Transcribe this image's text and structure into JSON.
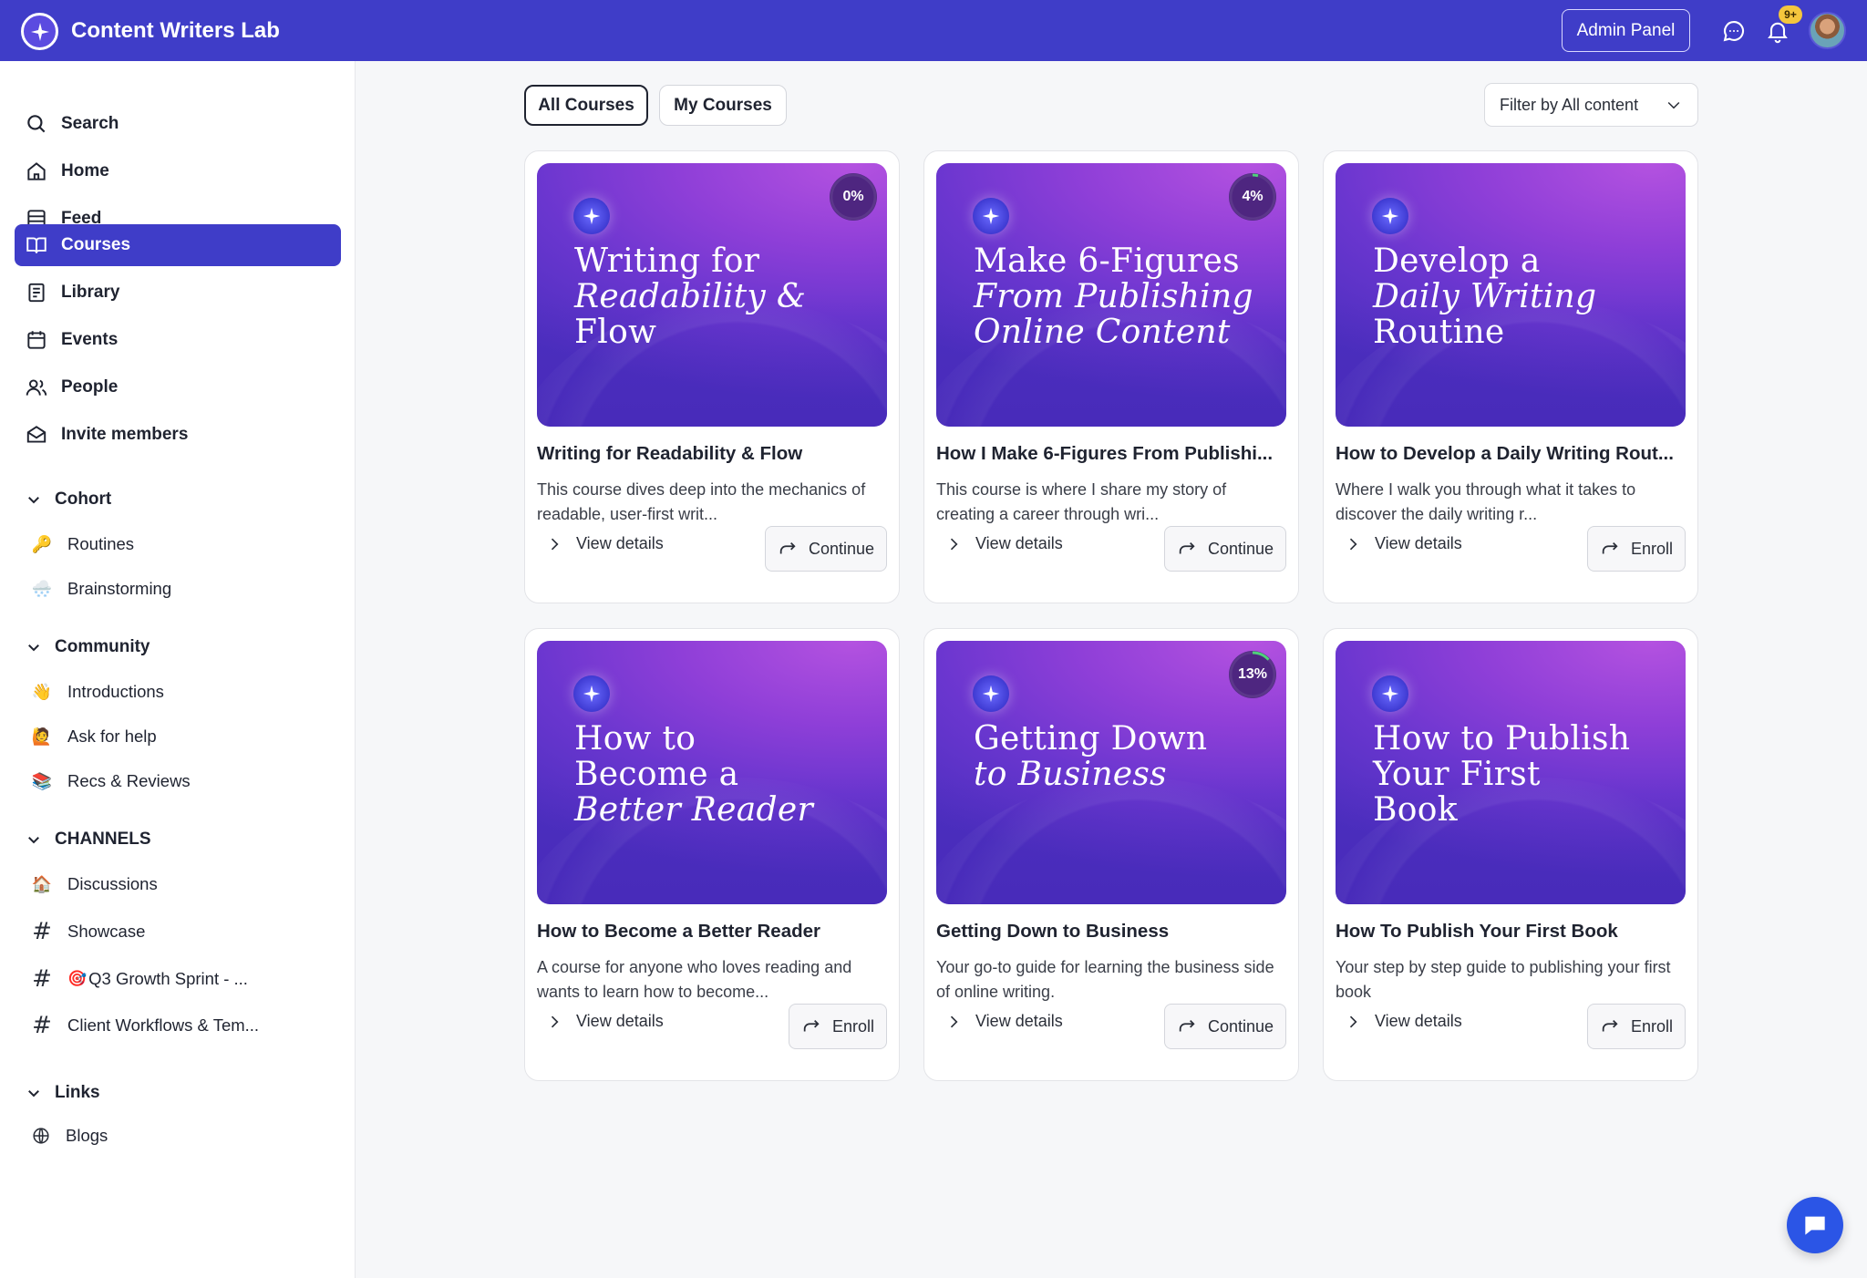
{
  "app": {
    "title": "Content Writers Lab",
    "admin_label": "Admin Panel",
    "notif_badge": "9+"
  },
  "sidebar": {
    "nav": [
      {
        "label": "Search",
        "icon": "search-icon"
      },
      {
        "label": "Home",
        "icon": "home-icon"
      },
      {
        "label": "Feed",
        "icon": "feed-icon"
      },
      {
        "label": "Courses",
        "icon": "book-open-icon",
        "active": true
      },
      {
        "label": "Library",
        "icon": "library-icon"
      },
      {
        "label": "Events",
        "icon": "calendar-icon"
      },
      {
        "label": "People",
        "icon": "people-icon"
      },
      {
        "label": "Invite members",
        "icon": "mail-icon"
      }
    ],
    "sections": [
      {
        "title": "Cohort",
        "items": [
          {
            "label": "Routines",
            "emoji": "🔑"
          },
          {
            "label": "Brainstorming",
            "emoji": "🌨️"
          }
        ]
      },
      {
        "title": "Community",
        "items": [
          {
            "label": "Introductions",
            "emoji": "👋"
          },
          {
            "label": "Ask for help",
            "emoji": "🙋"
          },
          {
            "label": "Recs & Reviews",
            "emoji": "📚"
          }
        ]
      },
      {
        "title": "CHANNELS",
        "items": [
          {
            "label": "Discussions",
            "emoji": "🏠"
          },
          {
            "label": "Showcase",
            "hash": "#"
          },
          {
            "label": "Q3 Growth Sprint - ...",
            "hash": "#",
            "emoji": "🎯"
          },
          {
            "label": "Client Workflows & Tem...",
            "hash": "#"
          }
        ]
      },
      {
        "title": "Links",
        "items": [
          {
            "label": "Blogs",
            "icon": "globe-icon"
          }
        ]
      }
    ]
  },
  "main": {
    "tabs": [
      "All Courses",
      "My Courses"
    ],
    "filter_label": "Filter by All content",
    "view_details_label": "View details",
    "courses": [
      {
        "cover_lines": [
          "Writing for",
          "Readability &",
          "Flow"
        ],
        "progress": "0%",
        "progress_value": 0,
        "title": "Writing for Readability & Flow",
        "desc": "This course dives deep into the mechanics of readable, user-first writ...",
        "action": "Continue"
      },
      {
        "cover_lines": [
          "Make 6-Figures",
          "From Publishing",
          "Online Content"
        ],
        "progress": "4%",
        "progress_value": 4,
        "title": "How I Make 6-Figures From Publishi...",
        "desc": "This course is where I share my story of creating a career through wri...",
        "action": "Continue"
      },
      {
        "cover_lines": [
          "Develop a",
          "Daily Writing",
          "Routine"
        ],
        "progress": "",
        "title": "How to Develop a Daily Writing Rout...",
        "desc": "Where I walk you through what it takes to discover the daily writing r...",
        "action": "Enroll"
      },
      {
        "cover_lines": [
          "How to",
          "Become a",
          "Better Reader"
        ],
        "progress": "",
        "title": "How to Become a Better Reader",
        "desc": "A course for anyone who loves reading and wants to learn how to become...",
        "action": "Enroll"
      },
      {
        "cover_lines": [
          "Getting Down",
          "to Business"
        ],
        "progress": "13%",
        "progress_value": 13,
        "title": "Getting Down to Business",
        "desc": "Your go-to guide for learning the business side of online writing.",
        "action": "Continue"
      },
      {
        "cover_lines": [
          "How to Publish",
          "Your First",
          "Book"
        ],
        "progress": "",
        "title": "How To Publish Your First Book",
        "desc": "Your step by step guide to publishing your first book",
        "action": "Enroll"
      }
    ]
  },
  "colors": {
    "brand": "#3f3dc8",
    "progress_arc": "#4fd17a",
    "fab": "#2b55e6"
  }
}
